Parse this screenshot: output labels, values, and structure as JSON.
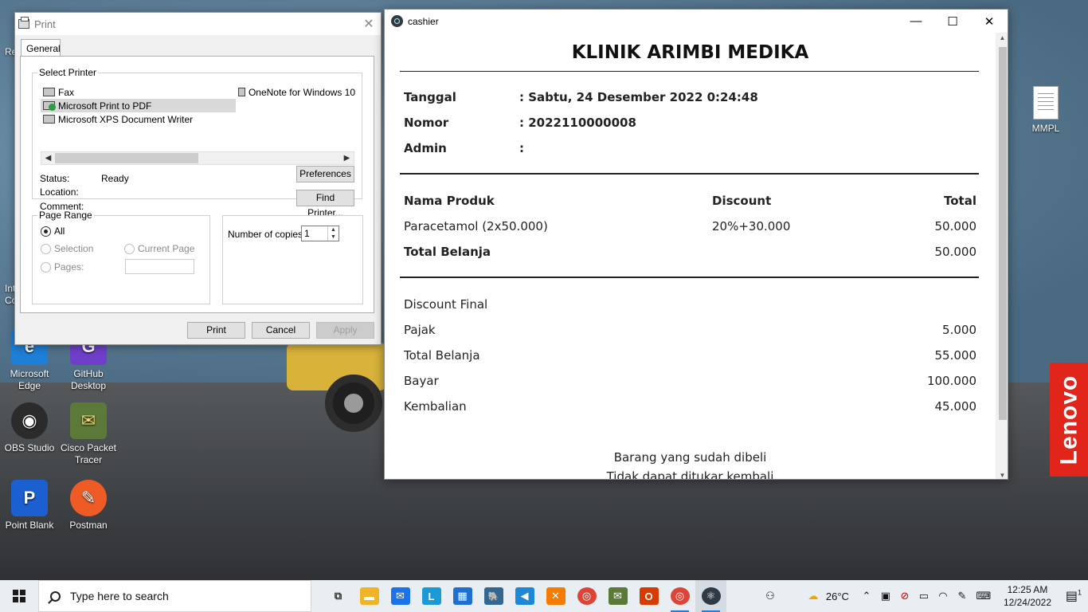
{
  "desktop": {
    "partial_labels": [
      "Re",
      "Int",
      "Co"
    ],
    "icons": [
      {
        "label": "Microsoft Edge",
        "glyph": "e",
        "color": "#1e7fd6"
      },
      {
        "label": "GitHub Desktop",
        "glyph": "G",
        "color": "#6e40c9"
      },
      {
        "label": "OBS Studio",
        "glyph": "◉",
        "color": "#2b2b2b"
      },
      {
        "label": "Cisco Packet Tracer",
        "glyph": "✉",
        "color": "#5b7a3a"
      },
      {
        "label": "Point Blank",
        "glyph": "P",
        "color": "#1c5fd1"
      },
      {
        "label": "Postman",
        "glyph": "✎",
        "color": "#ef5b25"
      }
    ],
    "mmpl_label": "MMPL",
    "lenovo": "Lenovo"
  },
  "print_dialog": {
    "title": "Print",
    "tab": "General",
    "select_printer_label": "Select Printer",
    "printers": [
      "Fax",
      "Microsoft Print to PDF",
      "Microsoft XPS Document Writer",
      "OneNote for Windows 10"
    ],
    "selected_printer": "Microsoft Print to PDF",
    "status_label": "Status:",
    "status_value": "Ready",
    "location_label": "Location:",
    "comment_label": "Comment:",
    "preferences_button": "Preferences",
    "find_printer_button": "Find Printer...",
    "page_range_label": "Page Range",
    "range_all": "All",
    "range_selection": "Selection",
    "range_current_page": "Current Page",
    "range_pages": "Pages:",
    "copies_label": "Number of copies:",
    "copies_value": "1",
    "print_button": "Print",
    "cancel_button": "Cancel",
    "apply_button": "Apply"
  },
  "cashier": {
    "window_title": "cashier",
    "clinic_name": "KLINIK ARIMBI MEDIKA",
    "tanggal_label": "Tanggal",
    "tanggal_value": ": Sabtu, 24 Desember 2022 0:24:48",
    "nomor_label": "Nomor",
    "nomor_value": ": 2022110000008",
    "admin_label": "Admin",
    "admin_value": ":",
    "table_headers": {
      "product": "Nama Produk",
      "discount": "Discount",
      "total": "Total"
    },
    "items": [
      {
        "product": "Paracetamol (2x50.000)",
        "discount": "20%+30.000",
        "total": "50.000"
      }
    ],
    "total_belanja_label": "Total Belanja",
    "total_belanja_value": "50.000",
    "summary": [
      {
        "label": "Discount Final",
        "value": ""
      },
      {
        "label": "Pajak",
        "value": "5.000"
      },
      {
        "label": "Total Belanja",
        "value": "55.000"
      },
      {
        "label": "Bayar",
        "value": "100.000"
      },
      {
        "label": "Kembalian",
        "value": "45.000"
      }
    ],
    "footer_line1": "Barang yang sudah dibeli",
    "footer_line2": "Tidak dapat ditukar kembali"
  },
  "taskbar": {
    "search_placeholder": "Type here to search",
    "apps": [
      {
        "name": "task-view",
        "glyph": "⧉",
        "color": "#333"
      },
      {
        "name": "file-explorer",
        "glyph": "▬",
        "color": "#f0b429"
      },
      {
        "name": "mail",
        "glyph": "✉",
        "color": "#1a73e8"
      },
      {
        "name": "l-app",
        "glyph": "L",
        "color": "#1c9ad6"
      },
      {
        "name": "store",
        "glyph": "▦",
        "color": "#1f6fd0"
      },
      {
        "name": "postgres",
        "glyph": "🐘",
        "color": "#336791"
      },
      {
        "name": "vscode",
        "glyph": "◀",
        "color": "#1e88d6"
      },
      {
        "name": "xampp",
        "glyph": "✕",
        "color": "#f57c00"
      },
      {
        "name": "chrome",
        "glyph": "◎",
        "color": "#db4437"
      },
      {
        "name": "packet-tracer",
        "glyph": "✉",
        "color": "#5b7a3a"
      },
      {
        "name": "office",
        "glyph": "O",
        "color": "#d83b01"
      },
      {
        "name": "chrome-2",
        "glyph": "◎",
        "color": "#db4437"
      },
      {
        "name": "electron",
        "glyph": "⚛",
        "color": "#2f3a44"
      }
    ],
    "weather": "26°C",
    "time": "12:25 AM",
    "date": "12/24/2022",
    "notification_count": "1"
  }
}
